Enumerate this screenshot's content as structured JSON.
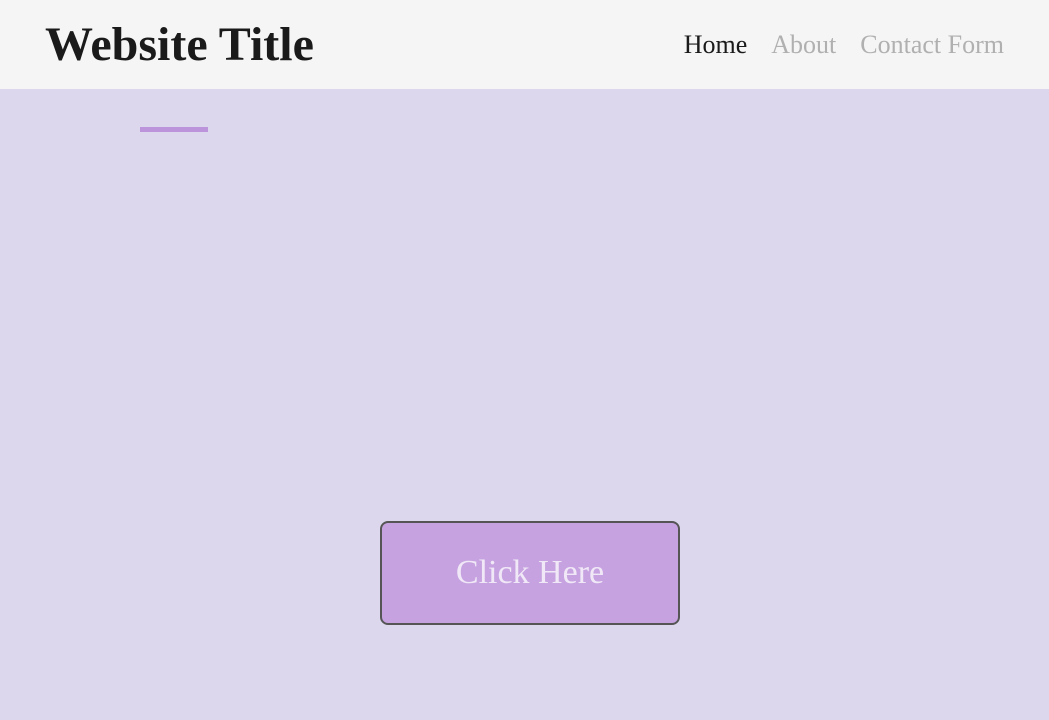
{
  "header": {
    "title": "Website Title"
  },
  "nav": {
    "items": [
      {
        "label": "Home",
        "active": true
      },
      {
        "label": "About",
        "active": false
      },
      {
        "label": "Contact Form",
        "active": false
      }
    ]
  },
  "hero": {
    "cta_label": "Click Here"
  },
  "colors": {
    "hero_bg": "#dcd7ed",
    "accent": "#bb94db",
    "button_bg": "#c6a3e0",
    "button_text": "#f0e8f7"
  }
}
